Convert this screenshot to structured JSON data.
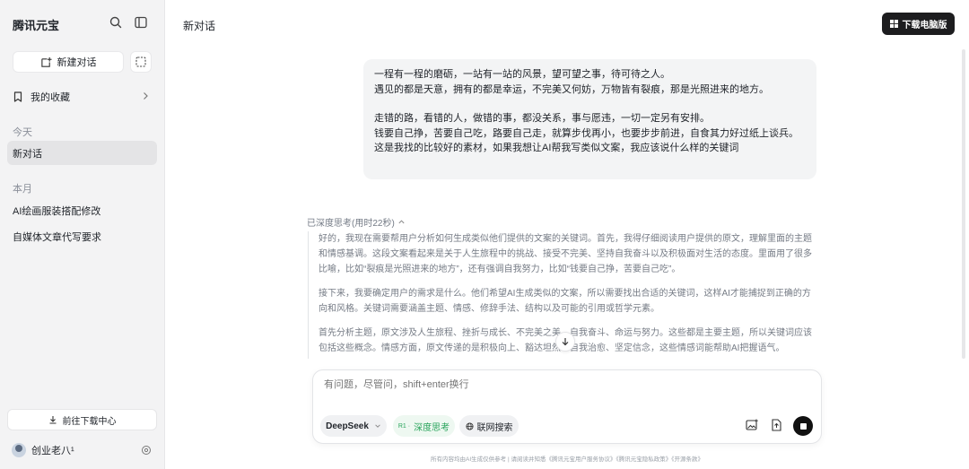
{
  "sidebar": {
    "brand": "腾讯元宝",
    "new_chat_label": "新建对话",
    "favorites_label": "我的收藏",
    "sections": [
      {
        "title": "今天",
        "items": [
          {
            "label": "新对话",
            "active": true
          }
        ]
      },
      {
        "title": "本月",
        "items": [
          {
            "label": "AI绘画服装搭配修改"
          },
          {
            "label": "自媒体文章代写要求"
          }
        ]
      }
    ],
    "download_center_label": "前往下载中心",
    "user_name": "创业老八¹"
  },
  "header": {
    "title": "新对话",
    "download_pc_label": "下载电脑版"
  },
  "conversation": {
    "user_message_lines": [
      "一程有一程的磨砺，一站有一站的风景，望可望之事，待可待之人。",
      "遇见的都是天意，拥有的都是幸运，不完美又何妨，万物皆有裂痕，那是光照进来的地方。",
      "",
      "走错的路，看错的人，做错的事，都没关系，事与愿违，一切一定另有安排。",
      "钱要自己挣，苦要自己吃，路要自己走，就算步伐再小，也要步步前进，自食其力好过纸上谈兵。",
      "这是我找的比较好的素材，如果我想让AI帮我写类似文案，我应该说什么样的关键词"
    ],
    "thinking_header": "已深度思考(用时22秒)",
    "thinking_paragraphs": [
      "好的，我现在需要帮用户分析如何生成类似他们提供的文案的关键词。首先，我得仔细阅读用户提供的原文，理解里面的主题和情感基调。这段文案看起来是关于人生旅程中的挑战、接受不完美、坚持自我奋斗以及积极面对生活的态度。里面用了很多比喻，比如“裂痕是光照进来的地方”，还有强调自我努力，比如“钱要自己挣，苦要自己吃”。",
      "接下来，我要确定用户的需求是什么。他们希望AI生成类似的文案，所以需要找出合适的关键词，这样AI才能捕捉到正确的方向和风格。关键词需要涵盖主题、情感、修辞手法、结构以及可能的引用或哲学元素。",
      "首先分析主题，原文涉及人生旅程、挫折与成长、不完美之美、自我奋斗、命运与努力。这些都是主要主题，所以关键词应该包括这些概念。情感方面，原文传递的是积极向上、豁达坦然、自我治愈、坚定信念，这些情感词能帮助AI把握语气。"
    ]
  },
  "composer": {
    "placeholder": "有问题，尽管问，shift+enter换行",
    "model_label": "DeepSeek",
    "deep_think_label": "深度思考",
    "deep_think_badge": "R1 ·",
    "web_search_label": "联网搜索"
  },
  "footer_text": "所有内容均由AI生成仅供参考 | 请阅读并知悉《腾讯元宝用户服务协议》《腾讯元宝隐私政策》《开源条款》",
  "colors": {
    "accent_green": "#27a35a",
    "dark_button": "#1d1d1f"
  }
}
